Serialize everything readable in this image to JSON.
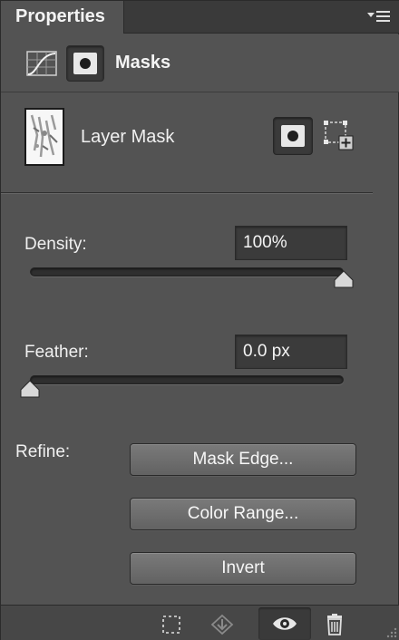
{
  "tab": {
    "title": "Properties"
  },
  "header": {
    "title": "Masks"
  },
  "layer": {
    "label": "Layer Mask"
  },
  "density": {
    "label": "Density:",
    "value": "100%",
    "level": 1.0
  },
  "feather": {
    "label": "Feather:",
    "value": "0.0 px",
    "level": 0.0
  },
  "refine": {
    "label": "Refine:",
    "buttons": [
      "Mask Edge...",
      "Color Range...",
      "Invert"
    ]
  },
  "icons": {
    "panel_menu": "panel-menu-icon",
    "adjustments": "curves-adjustment-icon",
    "mask": "pixel-mask-icon",
    "vector_mask": "vector-mask-icon",
    "load_selection": "load-selection-icon",
    "apply_mask": "apply-mask-icon",
    "visibility": "eye-icon",
    "delete": "trash-icon"
  },
  "colors": {
    "panel_bg": "#535353",
    "tab_bar_bg": "#3a3a3a",
    "field_bg": "#3b3b3b",
    "text": "#f0f0f0"
  }
}
